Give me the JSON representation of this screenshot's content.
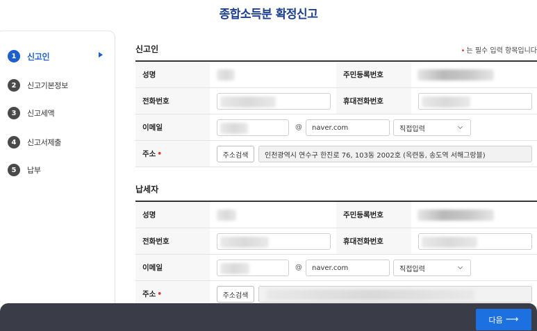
{
  "page": {
    "title": "종합소득분 확정신고"
  },
  "sidebar": {
    "steps": [
      {
        "num": "1",
        "label": "신고인",
        "active": true
      },
      {
        "num": "2",
        "label": "신고기본정보",
        "active": false
      },
      {
        "num": "3",
        "label": "신고세액",
        "active": false
      },
      {
        "num": "4",
        "label": "신고서제출",
        "active": false
      },
      {
        "num": "5",
        "label": "납부",
        "active": false
      }
    ]
  },
  "required_note": {
    "marker": "•",
    "text": "는 필수 입력 항목입니다"
  },
  "reporter": {
    "title": "신고인",
    "labels": {
      "name": "성명",
      "rrn": "주민등록번호",
      "phone": "전화번호",
      "mobile": "휴대전화번호",
      "email": "이메일",
      "address": "주소"
    },
    "email_at": "@",
    "email_domain": "naver.com",
    "email_select": "직접입력",
    "address_button": "주소검색",
    "address_value": "인천광역시 연수구 한진로 76, 103동 2002호 (옥련동, 송도역 서해그랑블)"
  },
  "taxpayer": {
    "title": "납세자",
    "labels": {
      "name": "성명",
      "rrn": "주민등록번호",
      "phone": "전화번호",
      "mobile": "휴대전화번호",
      "email": "이메일",
      "address": "주소"
    },
    "email_at": "@",
    "email_domain": "naver.com",
    "email_select": "직접입력",
    "address_button": "주소검색",
    "address_value": ""
  },
  "footer": {
    "next_label": "다음",
    "next_arrow": "⟶"
  },
  "colors": {
    "accent": "#1d5fcc",
    "title": "#1b3f8f",
    "required": "#e5322d",
    "bottom_bar": "#3a3d48",
    "next_button": "#1d70e0"
  }
}
